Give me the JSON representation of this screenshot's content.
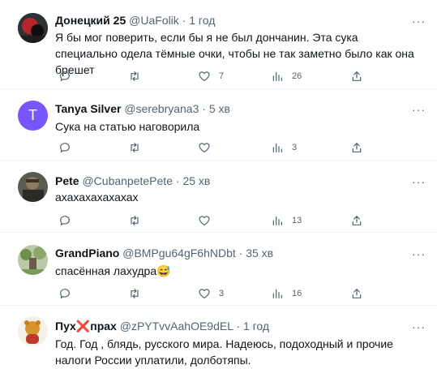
{
  "colors": {
    "accent": "#1d9bf0",
    "muted": "#536471",
    "text": "#0f1419",
    "avatar_tanya": "#7856ff"
  },
  "tweets": [
    {
      "name": "Донецкий 25",
      "handle": "@UaFolik",
      "time": "1 год",
      "text": "Я бы мог поверить, если бы я не был дончанин. Эта сука специально одела тёмные очки, чтобы не так заметно было как она брешет",
      "reply_count": "",
      "retweet_count": "",
      "like_count": "7",
      "view_count": "26",
      "avatar": "photo"
    },
    {
      "name": "Tanya Silver",
      "handle": "@serebryana3",
      "time": "5 хв",
      "text": "Сука на статью наговорила",
      "reply_count": "",
      "retweet_count": "",
      "like_count": "",
      "view_count": "3",
      "avatar_letter": "T"
    },
    {
      "name": "Pete",
      "handle": "@CubanpetePete",
      "time": "25 хв",
      "text": "ахахахахахахах",
      "reply_count": "",
      "retweet_count": "",
      "like_count": "",
      "view_count": "13",
      "avatar": "photo"
    },
    {
      "name": "GrandPiano",
      "handle": "@BMPgu64gF6hNDbt",
      "time": "35 хв",
      "text": "спасённая лахудра😅",
      "reply_count": "",
      "retweet_count": "",
      "like_count": "3",
      "view_count": "16",
      "avatar": "photo"
    },
    {
      "name_prefix": "Пух",
      "name_cross": "❌",
      "name_suffix": "прах",
      "handle": "@zPYTvvAahOE9dEL",
      "time": "1 год",
      "text": "Год. Год , блядь, русского мира. Надеюсь, подоходный и прочие налоги России уплатили, долботяпы.",
      "avatar": "photo"
    }
  ],
  "separator": " · ",
  "more_glyph": "···"
}
